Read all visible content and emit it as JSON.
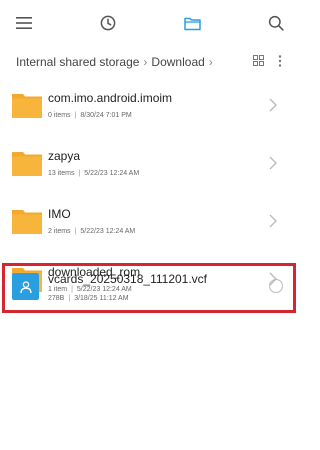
{
  "topbar": {
    "menu_icon": "menu-icon",
    "recent_icon": "clock-icon",
    "files_icon": "folder-icon",
    "search_icon": "search-icon",
    "accent_color": "#2a9fe0"
  },
  "breadcrumb": {
    "root": "Internal shared storage",
    "current": "Download",
    "view_icon": "grid-icon",
    "more_icon": "more-vertical-icon"
  },
  "folders": [
    {
      "name": "com.imo.android.imoim",
      "count": "0 items",
      "date": "8/30/24 7:01 PM"
    },
    {
      "name": "zapya",
      "count": "13 items",
      "date": "5/22/23 12:24 AM"
    },
    {
      "name": "IMO",
      "count": "2 items",
      "date": "5/22/23 12:24 AM"
    },
    {
      "name": "downloaded_rom",
      "count": "1 item",
      "date": "5/22/23 12:24 AM"
    }
  ],
  "file": {
    "name": "vcards_20250318_111201.vcf",
    "size": "278B",
    "date": "3/18/25 11:12 AM",
    "icon": "contact-file-icon",
    "highlight_color": "#d62430"
  },
  "folder_color": "#f7b53c"
}
